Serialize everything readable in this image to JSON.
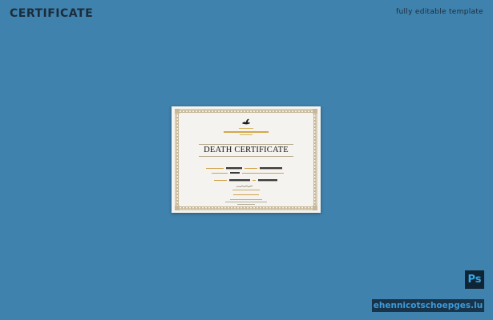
{
  "header": {
    "title": "CERTIFICATE",
    "tagline": "fully editable template"
  },
  "certificate": {
    "heading": "DEATH CERTIFICATE",
    "emblem_icon": "dove-icon",
    "accent_color": "#d4a848"
  },
  "badges": {
    "photoshop": "Ps",
    "watermark": "ehennicotschoepges.lu"
  },
  "colors": {
    "background": "#3f82ad",
    "paper": "#f4f3ef"
  }
}
